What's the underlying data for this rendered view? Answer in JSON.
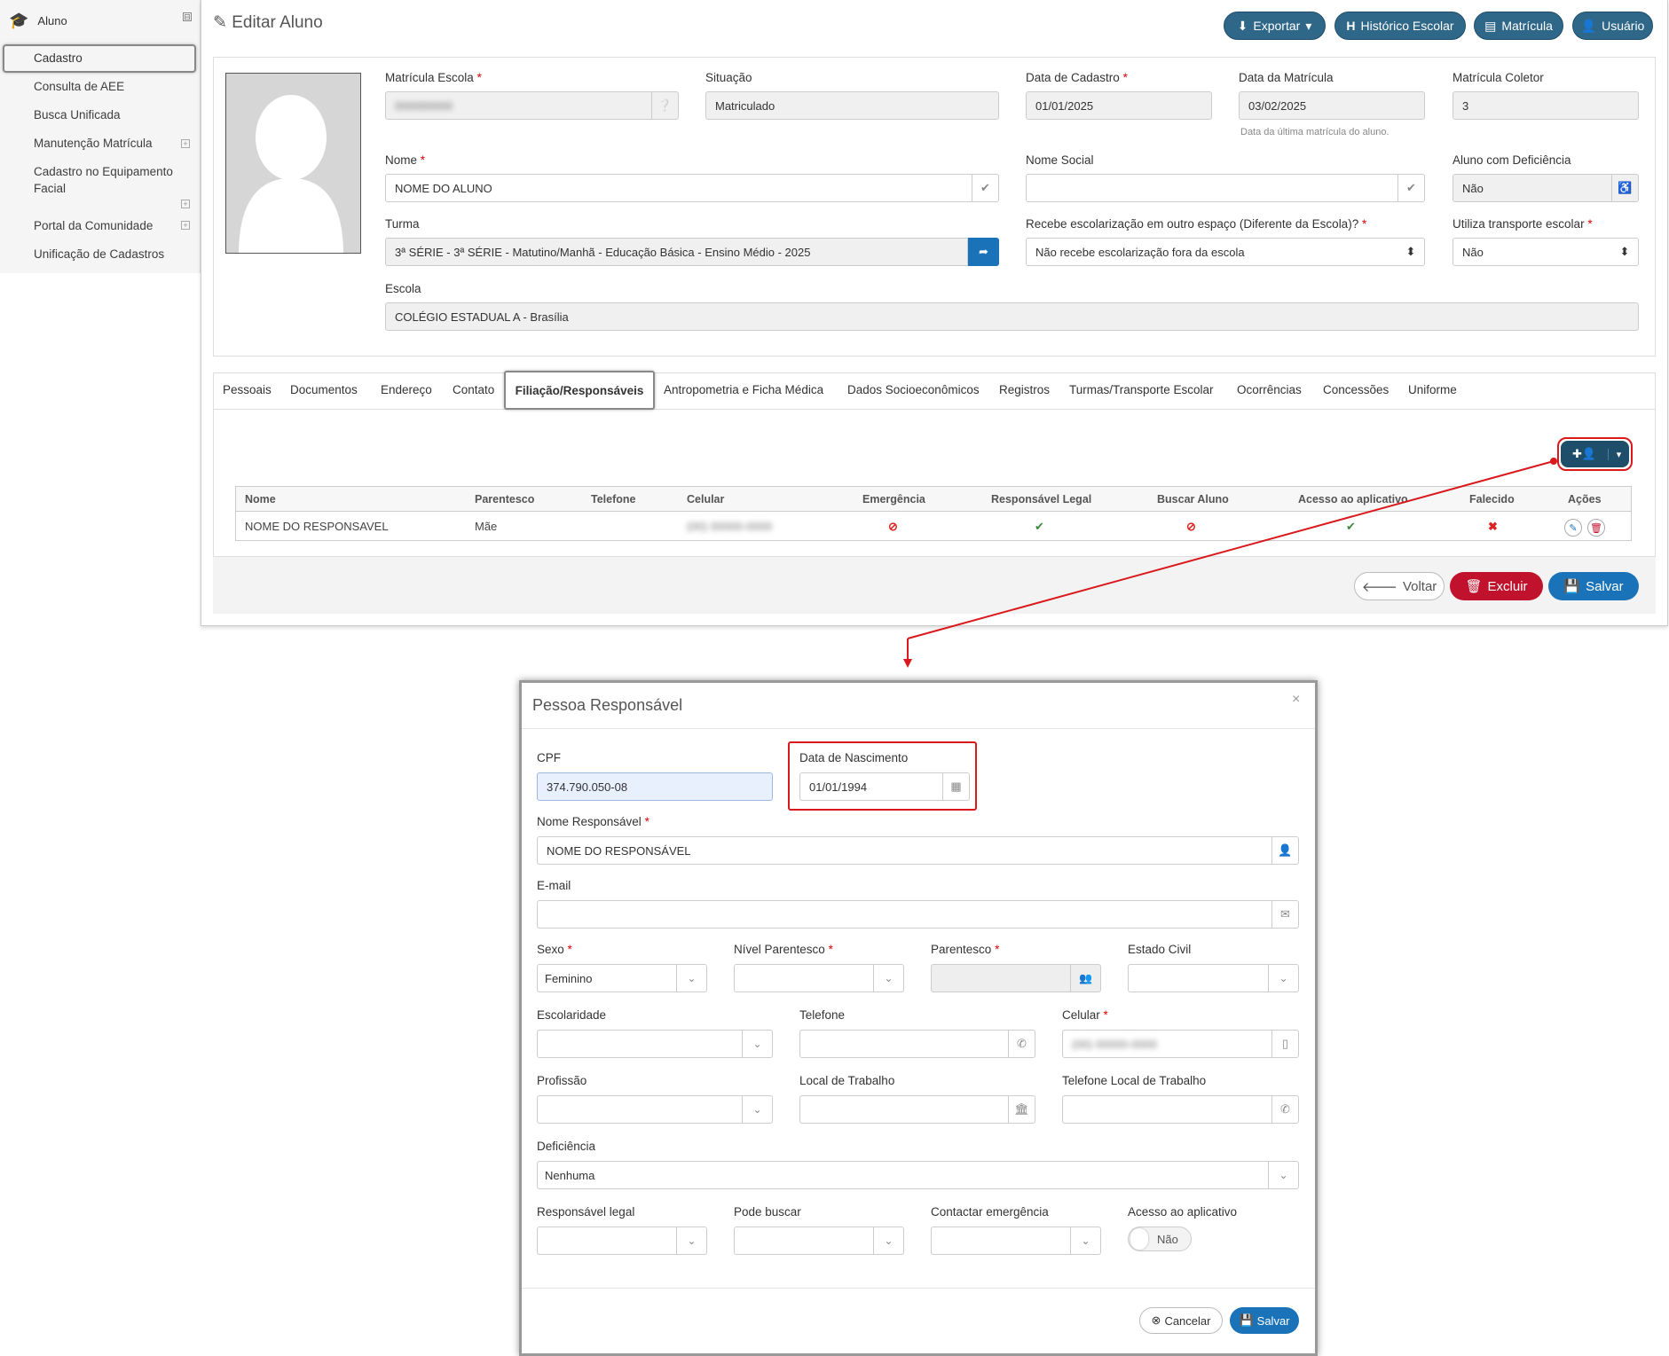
{
  "sidebar": {
    "header": "Aluno",
    "header_toggle": "⊟",
    "items": [
      {
        "label": "Cadastro"
      },
      {
        "label": "Consulta de AEE"
      },
      {
        "label": "Busca Unificada"
      },
      {
        "label": "Manutenção Matrícula"
      },
      {
        "label": "Cadastro no Equipamento Facial"
      },
      {
        "label": "Portal da Comunidade"
      },
      {
        "label": "Unificação de Cadastros"
      }
    ]
  },
  "page": {
    "title": "Editar Aluno"
  },
  "header_buttons": {
    "exportar": "Exportar",
    "historico": "Histórico Escolar",
    "matricula": "Matrícula",
    "usuario": "Usuário"
  },
  "form": {
    "matricula_escola": {
      "label": "Matrícula Escola",
      "value": "000000000"
    },
    "situacao": {
      "label": "Situação",
      "value": "Matriculado"
    },
    "data_cadastro": {
      "label": "Data de Cadastro",
      "value": "01/01/2025"
    },
    "data_matricula": {
      "label": "Data da Matrícula",
      "value": "03/02/2025",
      "hint": "Data da última matrícula do aluno."
    },
    "matricula_coletor": {
      "label": "Matrícula Coletor",
      "value": "3"
    },
    "nome": {
      "label": "Nome",
      "value": "NOME DO ALUNO"
    },
    "nome_social": {
      "label": "Nome Social",
      "value": ""
    },
    "aluno_deficiencia": {
      "label": "Aluno com Deficiência",
      "value": "Não"
    },
    "turma": {
      "label": "Turma",
      "value": "3ª SÉRIE - 3ª SÉRIE - Matutino/Manhã - Educação Básica - Ensino Médio - 2025"
    },
    "escolarizacao": {
      "label": "Recebe escolarização em outro espaço (Diferente da Escola)?",
      "value": "Não recebe escolarização fora da escola"
    },
    "transporte": {
      "label": "Utiliza transporte escolar",
      "value": "Não"
    },
    "escola": {
      "label": "Escola",
      "value": "COLÉGIO ESTADUAL A - Brasília"
    }
  },
  "tabs": [
    "Pessoais",
    "Documentos",
    "Endereço",
    "Contato",
    "Filiação/Responsáveis",
    "Antropometria e Ficha Médica",
    "Dados Socioeconômicos",
    "Registros",
    "Turmas/Transporte Escolar",
    "Ocorrências",
    "Concessões",
    "Uniforme"
  ],
  "table": {
    "headers": [
      "Nome",
      "Parentesco",
      "Telefone",
      "Celular",
      "Emergência",
      "Responsável Legal",
      "Buscar Aluno",
      "Acesso ao aplicativo",
      "Falecido",
      "Ações"
    ],
    "row": {
      "nome": "NOME DO RESPONSAVEL",
      "parentesco": "Mãe",
      "telefone": "",
      "celular": "(00) 00000-0000"
    }
  },
  "footer_buttons": {
    "voltar": "Voltar",
    "excluir": "Excluir",
    "salvar": "Salvar"
  },
  "modal": {
    "title": "Pessoa Responsável",
    "close": "×",
    "cpf": {
      "label": "CPF",
      "value": "374.790.050-08"
    },
    "data_nascimento": {
      "label": "Data de Nascimento",
      "value": "01/01/1994"
    },
    "nome_responsavel": {
      "label": "Nome Responsável",
      "value": "NOME DO RESPONSÁVEL"
    },
    "email": {
      "label": "E-mail",
      "value": ""
    },
    "sexo": {
      "label": "Sexo",
      "value": "Feminino"
    },
    "nivel_parentesco": {
      "label": "Nível Parentesco",
      "value": ""
    },
    "parentesco": {
      "label": "Parentesco",
      "value": ""
    },
    "estado_civil": {
      "label": "Estado Civil",
      "value": ""
    },
    "escolaridade": {
      "label": "Escolaridade",
      "value": ""
    },
    "telefone": {
      "label": "Telefone",
      "value": ""
    },
    "celular": {
      "label": "Celular",
      "value": "(00) 00000-0000"
    },
    "profissao": {
      "label": "Profissão",
      "value": ""
    },
    "local_trabalho": {
      "label": "Local de Trabalho",
      "value": ""
    },
    "telefone_trabalho": {
      "label": "Telefone Local de Trabalho",
      "value": ""
    },
    "deficiencia": {
      "label": "Deficiência",
      "value": "Nenhuma"
    },
    "responsavel_legal": {
      "label": "Responsável legal",
      "value": ""
    },
    "pode_buscar": {
      "label": "Pode buscar",
      "value": ""
    },
    "contactar_emergencia": {
      "label": "Contactar emergência",
      "value": ""
    },
    "acesso_aplicativo": {
      "label": "Acesso ao aplicativo",
      "value": "Não"
    },
    "cancelar": "Cancelar",
    "salvar": "Salvar"
  },
  "colors": {
    "primary": "#2f6789",
    "blue": "#1a73b8",
    "danger": "#c0122c",
    "annotation": "#d9191c"
  }
}
